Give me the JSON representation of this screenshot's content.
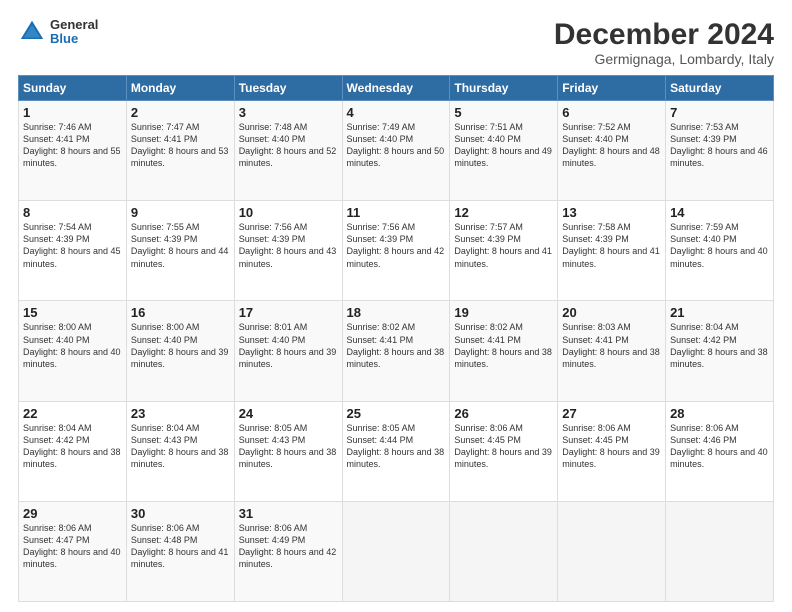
{
  "logo": {
    "line1": "General",
    "line2": "Blue"
  },
  "title": "December 2024",
  "subtitle": "Germignaga, Lombardy, Italy",
  "header_days": [
    "Sunday",
    "Monday",
    "Tuesday",
    "Wednesday",
    "Thursday",
    "Friday",
    "Saturday"
  ],
  "weeks": [
    [
      {
        "day": "1",
        "sunrise": "Sunrise: 7:46 AM",
        "sunset": "Sunset: 4:41 PM",
        "daylight": "Daylight: 8 hours and 55 minutes."
      },
      {
        "day": "2",
        "sunrise": "Sunrise: 7:47 AM",
        "sunset": "Sunset: 4:41 PM",
        "daylight": "Daylight: 8 hours and 53 minutes."
      },
      {
        "day": "3",
        "sunrise": "Sunrise: 7:48 AM",
        "sunset": "Sunset: 4:40 PM",
        "daylight": "Daylight: 8 hours and 52 minutes."
      },
      {
        "day": "4",
        "sunrise": "Sunrise: 7:49 AM",
        "sunset": "Sunset: 4:40 PM",
        "daylight": "Daylight: 8 hours and 50 minutes."
      },
      {
        "day": "5",
        "sunrise": "Sunrise: 7:51 AM",
        "sunset": "Sunset: 4:40 PM",
        "daylight": "Daylight: 8 hours and 49 minutes."
      },
      {
        "day": "6",
        "sunrise": "Sunrise: 7:52 AM",
        "sunset": "Sunset: 4:40 PM",
        "daylight": "Daylight: 8 hours and 48 minutes."
      },
      {
        "day": "7",
        "sunrise": "Sunrise: 7:53 AM",
        "sunset": "Sunset: 4:39 PM",
        "daylight": "Daylight: 8 hours and 46 minutes."
      }
    ],
    [
      {
        "day": "8",
        "sunrise": "Sunrise: 7:54 AM",
        "sunset": "Sunset: 4:39 PM",
        "daylight": "Daylight: 8 hours and 45 minutes."
      },
      {
        "day": "9",
        "sunrise": "Sunrise: 7:55 AM",
        "sunset": "Sunset: 4:39 PM",
        "daylight": "Daylight: 8 hours and 44 minutes."
      },
      {
        "day": "10",
        "sunrise": "Sunrise: 7:56 AM",
        "sunset": "Sunset: 4:39 PM",
        "daylight": "Daylight: 8 hours and 43 minutes."
      },
      {
        "day": "11",
        "sunrise": "Sunrise: 7:56 AM",
        "sunset": "Sunset: 4:39 PM",
        "daylight": "Daylight: 8 hours and 42 minutes."
      },
      {
        "day": "12",
        "sunrise": "Sunrise: 7:57 AM",
        "sunset": "Sunset: 4:39 PM",
        "daylight": "Daylight: 8 hours and 41 minutes."
      },
      {
        "day": "13",
        "sunrise": "Sunrise: 7:58 AM",
        "sunset": "Sunset: 4:39 PM",
        "daylight": "Daylight: 8 hours and 41 minutes."
      },
      {
        "day": "14",
        "sunrise": "Sunrise: 7:59 AM",
        "sunset": "Sunset: 4:40 PM",
        "daylight": "Daylight: 8 hours and 40 minutes."
      }
    ],
    [
      {
        "day": "15",
        "sunrise": "Sunrise: 8:00 AM",
        "sunset": "Sunset: 4:40 PM",
        "daylight": "Daylight: 8 hours and 40 minutes."
      },
      {
        "day": "16",
        "sunrise": "Sunrise: 8:00 AM",
        "sunset": "Sunset: 4:40 PM",
        "daylight": "Daylight: 8 hours and 39 minutes."
      },
      {
        "day": "17",
        "sunrise": "Sunrise: 8:01 AM",
        "sunset": "Sunset: 4:40 PM",
        "daylight": "Daylight: 8 hours and 39 minutes."
      },
      {
        "day": "18",
        "sunrise": "Sunrise: 8:02 AM",
        "sunset": "Sunset: 4:41 PM",
        "daylight": "Daylight: 8 hours and 38 minutes."
      },
      {
        "day": "19",
        "sunrise": "Sunrise: 8:02 AM",
        "sunset": "Sunset: 4:41 PM",
        "daylight": "Daylight: 8 hours and 38 minutes."
      },
      {
        "day": "20",
        "sunrise": "Sunrise: 8:03 AM",
        "sunset": "Sunset: 4:41 PM",
        "daylight": "Daylight: 8 hours and 38 minutes."
      },
      {
        "day": "21",
        "sunrise": "Sunrise: 8:04 AM",
        "sunset": "Sunset: 4:42 PM",
        "daylight": "Daylight: 8 hours and 38 minutes."
      }
    ],
    [
      {
        "day": "22",
        "sunrise": "Sunrise: 8:04 AM",
        "sunset": "Sunset: 4:42 PM",
        "daylight": "Daylight: 8 hours and 38 minutes."
      },
      {
        "day": "23",
        "sunrise": "Sunrise: 8:04 AM",
        "sunset": "Sunset: 4:43 PM",
        "daylight": "Daylight: 8 hours and 38 minutes."
      },
      {
        "day": "24",
        "sunrise": "Sunrise: 8:05 AM",
        "sunset": "Sunset: 4:43 PM",
        "daylight": "Daylight: 8 hours and 38 minutes."
      },
      {
        "day": "25",
        "sunrise": "Sunrise: 8:05 AM",
        "sunset": "Sunset: 4:44 PM",
        "daylight": "Daylight: 8 hours and 38 minutes."
      },
      {
        "day": "26",
        "sunrise": "Sunrise: 8:06 AM",
        "sunset": "Sunset: 4:45 PM",
        "daylight": "Daylight: 8 hours and 39 minutes."
      },
      {
        "day": "27",
        "sunrise": "Sunrise: 8:06 AM",
        "sunset": "Sunset: 4:45 PM",
        "daylight": "Daylight: 8 hours and 39 minutes."
      },
      {
        "day": "28",
        "sunrise": "Sunrise: 8:06 AM",
        "sunset": "Sunset: 4:46 PM",
        "daylight": "Daylight: 8 hours and 40 minutes."
      }
    ],
    [
      {
        "day": "29",
        "sunrise": "Sunrise: 8:06 AM",
        "sunset": "Sunset: 4:47 PM",
        "daylight": "Daylight: 8 hours and 40 minutes."
      },
      {
        "day": "30",
        "sunrise": "Sunrise: 8:06 AM",
        "sunset": "Sunset: 4:48 PM",
        "daylight": "Daylight: 8 hours and 41 minutes."
      },
      {
        "day": "31",
        "sunrise": "Sunrise: 8:06 AM",
        "sunset": "Sunset: 4:49 PM",
        "daylight": "Daylight: 8 hours and 42 minutes."
      },
      null,
      null,
      null,
      null
    ]
  ]
}
